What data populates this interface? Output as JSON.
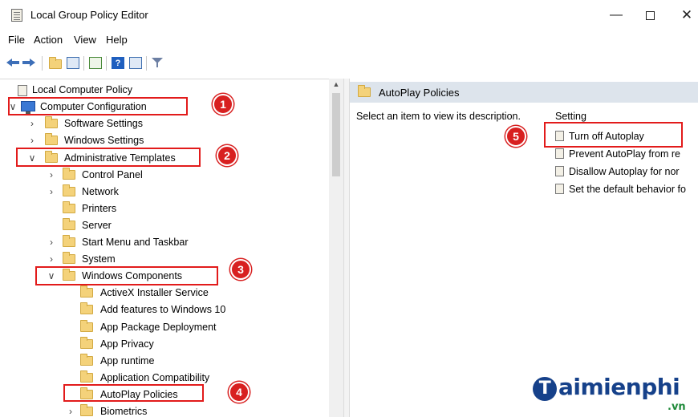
{
  "window": {
    "title": "Local Group Policy Editor",
    "min_glyph": "—",
    "close_glyph": "✕"
  },
  "menu": [
    "File",
    "Action",
    "View",
    "Help"
  ],
  "toolbar": {
    "icons": [
      "back-arrow-icon",
      "forward-arrow-icon",
      "up-folder-icon",
      "show-hide-tree-icon",
      "export-list-icon",
      "help-icon",
      "properties-icon",
      "filter-icon"
    ],
    "help_glyph": "?"
  },
  "tree": {
    "root": "Local Computer Policy",
    "computer_configuration": "Computer Configuration",
    "software_settings": "Software Settings",
    "windows_settings": "Windows Settings",
    "administrative_templates": "Administrative Templates",
    "control_panel": "Control Panel",
    "network": "Network",
    "printers": "Printers",
    "server": "Server",
    "start_menu": "Start Menu and Taskbar",
    "system": "System",
    "windows_components": "Windows Components",
    "activex": "ActiveX Installer Service",
    "add_features": "Add features to Windows 10",
    "app_package": "App Package Deployment",
    "app_privacy": "App Privacy",
    "app_runtime": "App runtime",
    "app_compat": "Application Compatibility",
    "autoplay": "AutoPlay Policies",
    "biometrics": "Biometrics"
  },
  "chevrons": {
    "expanded": "∨",
    "collapsed": "›"
  },
  "right": {
    "header": "AutoPlay Policies",
    "description": "Select an item to view its description.",
    "column": "Setting",
    "settings": [
      "Turn off Autoplay",
      "Prevent AutoPlay from re",
      "Disallow Autoplay for nor",
      "Set the default behavior fo"
    ]
  },
  "badges": [
    "1",
    "2",
    "3",
    "4",
    "5"
  ],
  "watermark": {
    "letter": "T",
    "text": "aimienphi",
    "suffix": ".vn"
  },
  "colors": {
    "highlight_red": "#e21b1b",
    "badge_red": "#d82020",
    "brand_blue": "#16418a"
  }
}
